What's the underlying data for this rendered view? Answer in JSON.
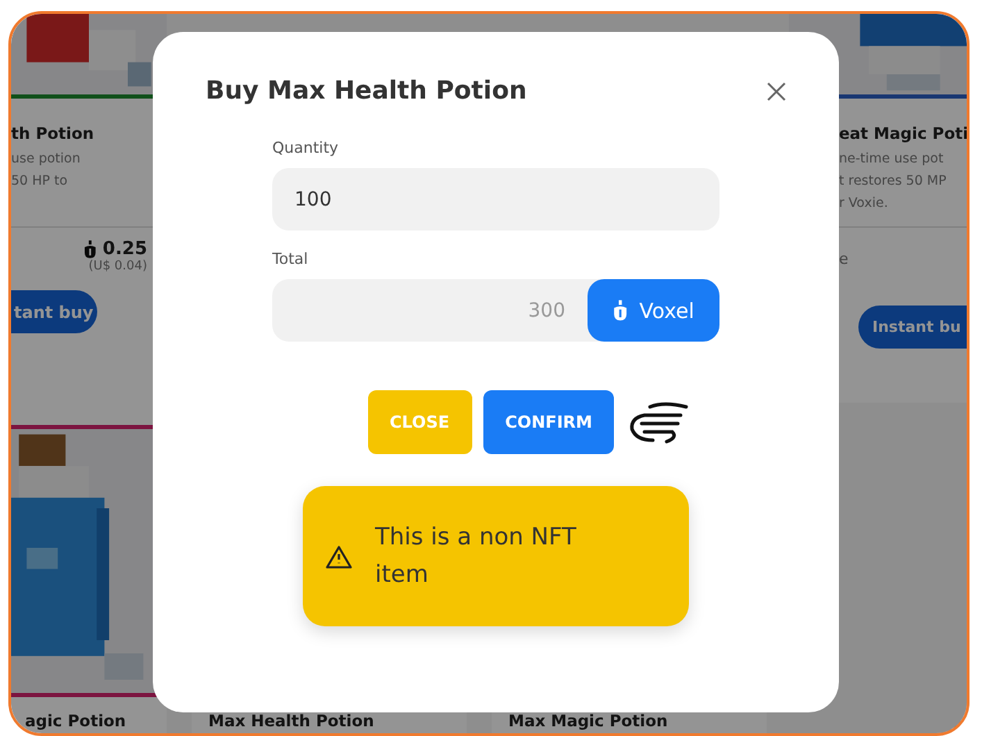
{
  "background_cards": [
    {
      "title": "th Potion",
      "description": "use potion\n50 HP to",
      "price": "0.25",
      "price_usd": "(U$ 0.04)",
      "button": "tant buy"
    },
    {
      "title": "eat Magic Poti",
      "description": "ne-time use pot\nt restores 50 MP\nr Voxie.",
      "status": "e",
      "button": "Instant bu"
    }
  ],
  "bottom_titles": [
    "agic Potion",
    "Max Health Potion",
    "Max Magic Potion"
  ],
  "dialog": {
    "title": "Buy Max Health Potion",
    "quantity": {
      "label": "Quantity",
      "value": "100"
    },
    "total": {
      "label": "Total",
      "value": "300",
      "currency": "Voxel"
    },
    "buttons": [
      {
        "kind": "secondary",
        "label": "CLOSE"
      },
      {
        "kind": "primary",
        "label": "CONFIRM"
      }
    ],
    "alert": "This is a non NFT item"
  }
}
